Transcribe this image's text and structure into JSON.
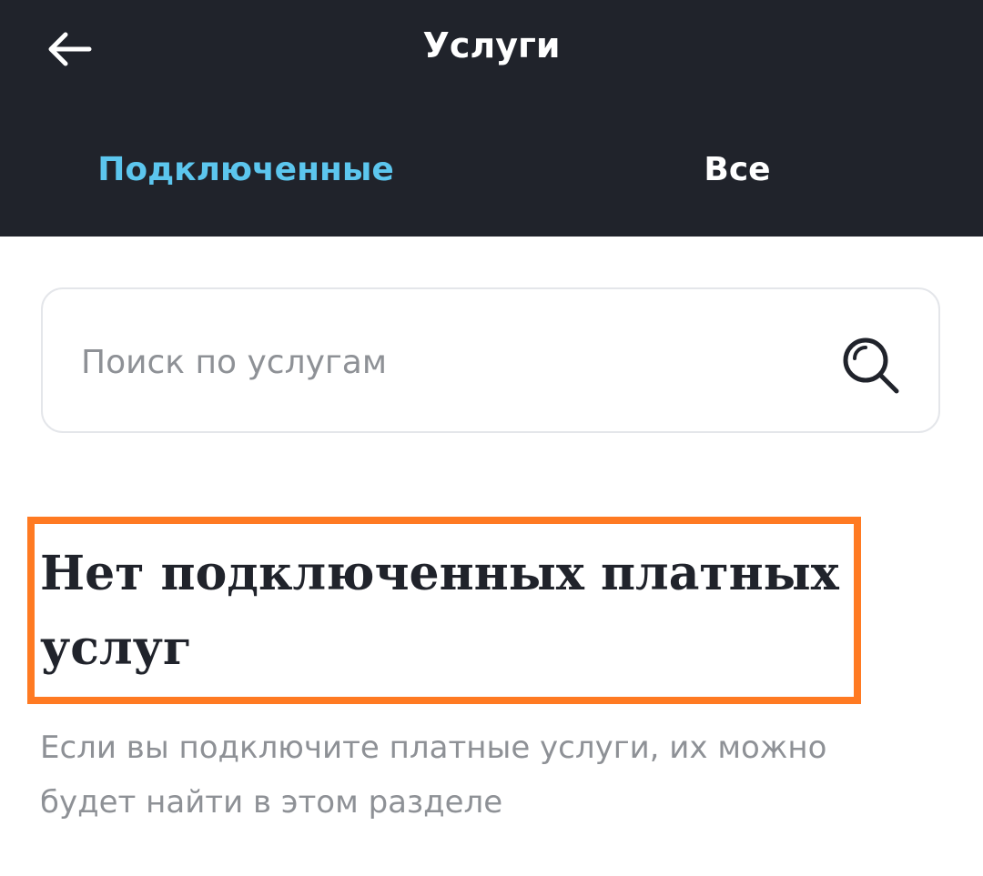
{
  "header": {
    "title": "Услуги",
    "back_icon": "arrow-left-icon",
    "background_color": "#20232b"
  },
  "tabs": [
    {
      "label": "Подключенные",
      "active": true,
      "color": "#5cc6ee"
    },
    {
      "label": "Все",
      "active": false,
      "color": "#ffffff"
    }
  ],
  "search": {
    "placeholder": "Поиск по услугам",
    "value": "",
    "icon": "search-icon"
  },
  "empty_state": {
    "title": "Нет подключенных платных услуг",
    "description": "Если вы подключите платные услуги, их можно будет найти в этом разделе",
    "highlight_color": "#ff7a22"
  }
}
